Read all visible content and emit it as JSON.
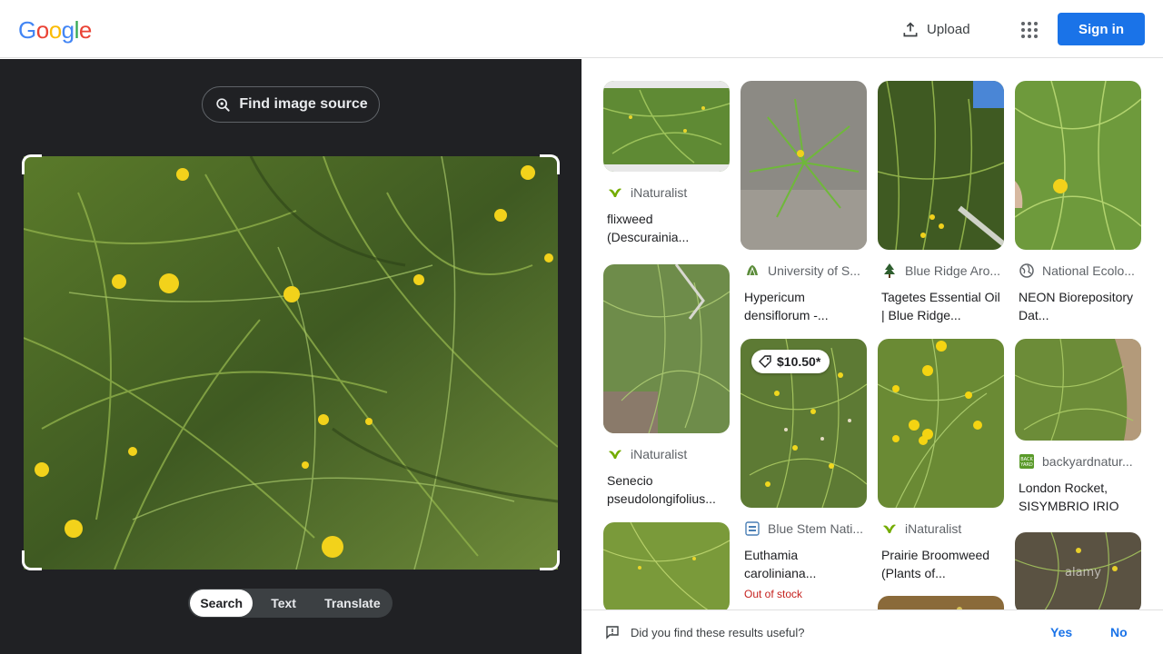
{
  "header": {
    "logo_letters": [
      "G",
      "o",
      "o",
      "g",
      "l",
      "e"
    ],
    "logo_colors": [
      "#4285f4",
      "#ea4335",
      "#fbbc05",
      "#4285f4",
      "#34a853",
      "#ea4335"
    ],
    "upload_label": "Upload",
    "signin_label": "Sign in"
  },
  "lens": {
    "find_source_label": "Find image source",
    "modes": [
      "Search",
      "Text",
      "Translate"
    ],
    "active_mode": "Search"
  },
  "results": [
    {
      "source": "iNaturalist",
      "title": "flixweed (Descurainia...",
      "source_icon": "inaturalist-icon"
    },
    {
      "source": "University of S...",
      "title": "Hypericum densiflorum -...",
      "source_icon": "university-icon"
    },
    {
      "source": "Blue Ridge Aro...",
      "title": "Tagetes Essential Oil | Blue Ridge...",
      "source_icon": "tree-icon"
    },
    {
      "source": "National Ecolo...",
      "title": "NEON Biorepository Dat...",
      "source_icon": "globe-icon"
    },
    {
      "source": "iNaturalist",
      "title": "Senecio pseudolongifolius...",
      "source_icon": "inaturalist-icon"
    },
    {
      "source": "Blue Stem Nati...",
      "title": "Euthamia caroliniana...",
      "source_icon": "store-icon",
      "price": "$10.50*",
      "status": "Out of stock"
    },
    {
      "source": "iNaturalist",
      "title": "Prairie Broomweed (Plants of...",
      "source_icon": "inaturalist-icon"
    },
    {
      "source": "backyardnatur...",
      "title": "London Rocket, SISYMBRIO IRIO",
      "source_icon": "backyard-icon"
    },
    {
      "source": "",
      "title": "",
      "source_icon": "",
      "watermark": "alamy"
    }
  ],
  "feedback": {
    "question": "Did you find these results useful?",
    "yes_label": "Yes",
    "no_label": "No"
  },
  "colors": {
    "accent": "#1a73e8",
    "dark_panel": "#202124",
    "out_of_stock": "#c5221f"
  }
}
